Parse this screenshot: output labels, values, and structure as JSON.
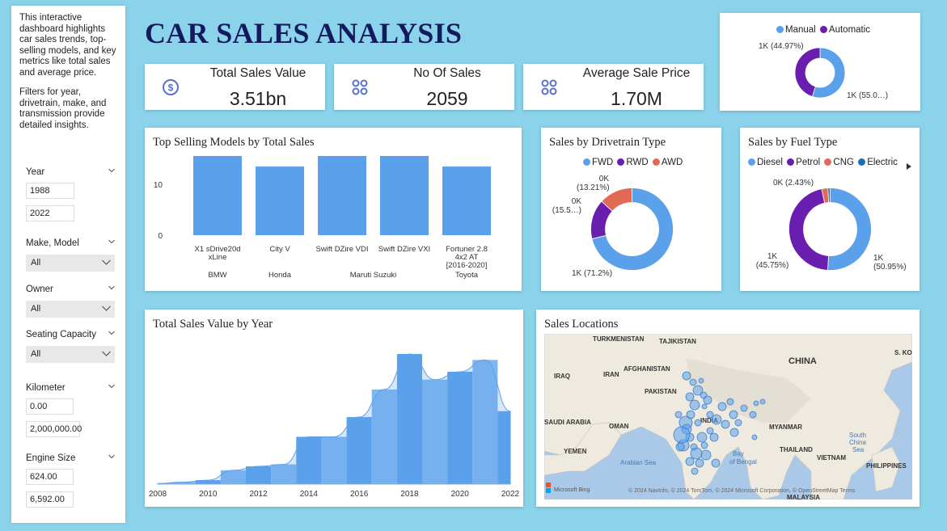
{
  "intro": {
    "p1": "This interactive dashboard highlights car sales trends, top-selling models, and key metrics like total sales and average price.",
    "p2": "Filters for year, drivetrain, make, and transmission provide detailed insights."
  },
  "filters": {
    "year": {
      "label": "Year",
      "from": "1988",
      "to": "2022"
    },
    "make_model": {
      "label": "Make, Model",
      "value": "All"
    },
    "owner": {
      "label": "Owner",
      "value": "All"
    },
    "seating": {
      "label": "Seating Capacity",
      "value": "All"
    },
    "kilometer": {
      "label": "Kilometer",
      "from": "0.00",
      "to": "2,000,000.00"
    },
    "engine": {
      "label": "Engine Size",
      "from": "624.00",
      "to": "6,592.00"
    }
  },
  "title": "CAR SALES ANALYSIS",
  "kpis": [
    {
      "label": "Total Sales Value",
      "value": "3.51bn",
      "icon": "dollar-circle-icon"
    },
    {
      "label": "No Of Sales",
      "value": "2059",
      "icon": "grid-circles-icon"
    },
    {
      "label": "Average Sale Price",
      "value": "1.70M",
      "icon": "grid-circles-icon"
    }
  ],
  "colors": {
    "blue": "#5aa0ea",
    "purple": "#6a1eb0",
    "orange": "#e16a55",
    "darkblue": "#1a6fb8",
    "navy": "#141a5e",
    "bg": "#8ad3ea"
  },
  "chart_data": [
    {
      "type": "pie",
      "name": "transmission",
      "legend": [
        "Manual",
        "Automatic"
      ],
      "labels": [
        "1K (55.0…)",
        "1K (44.97%)"
      ],
      "values": [
        55.03,
        44.97
      ]
    },
    {
      "type": "bar",
      "title": "Top Selling Models by Total Sales",
      "categories": [
        "X1 sDrive20d xLine",
        "City V",
        "Swift DZire VDI",
        "Swift DZire VXI",
        "Fortuner 2.8 4x2 AT [2016-2020]"
      ],
      "groups": [
        "BMW",
        "Honda",
        "Maruti Suzuki",
        "Toyota"
      ],
      "values": [
        15,
        13,
        15,
        15,
        13
      ],
      "yticks": [
        "10",
        "0"
      ],
      "ylim": [
        0,
        15
      ]
    },
    {
      "type": "pie",
      "title": "Sales by Drivetrain Type",
      "legend": [
        "FWD",
        "RWD",
        "AWD"
      ],
      "labels": [
        "1K (71.2%)",
        "0K (15.5…)",
        "0K (13.21%)"
      ],
      "values": [
        71.2,
        15.59,
        13.21
      ]
    },
    {
      "type": "pie",
      "title": "Sales by Fuel Type",
      "legend": [
        "Diesel",
        "Petrol",
        "CNG",
        "Electric"
      ],
      "labels": [
        "1K (50.95%)",
        "1K (45.75%)",
        "0K (2.43%)",
        ""
      ],
      "values": [
        50.95,
        45.75,
        2.43,
        0.87
      ]
    },
    {
      "type": "area",
      "title": "Total Sales Value by Year",
      "x": [
        2008,
        2009,
        2010,
        2011,
        2012,
        2013,
        2014,
        2015,
        2016,
        2017,
        2018,
        2019,
        2020,
        2021,
        2022
      ],
      "y": [
        0.3,
        1,
        2,
        7,
        9,
        10,
        24,
        24,
        34,
        48,
        66,
        53,
        57,
        63,
        37
      ],
      "xticks": [
        "2008",
        "2010",
        "2012",
        "2014",
        "2016",
        "2018",
        "2020",
        "2022"
      ]
    }
  ],
  "map": {
    "title": "Sales Locations",
    "labels": [
      "TURKMENISTAN",
      "TAJIKISTAN",
      "IRAQ",
      "IRAN",
      "AFGHANISTAN",
      "PAKISTAN",
      "CHINA",
      "S. KOI",
      "SAUDI ARABIA",
      "OMAN",
      "INDIA",
      "MYANMAR",
      "THAILAND",
      "YEMEN",
      "Arabian Sea",
      "Bay of Bengal",
      "VIETNAM",
      "South China Sea",
      "PHILIPPINES",
      "MALAYSIA"
    ],
    "attribution": "© 2024 NavInfo, © 2024 TomTom, © 2024 Microsoft Corporation, © OpenStreetMap  Terms",
    "bing": "Microsoft Bing"
  }
}
